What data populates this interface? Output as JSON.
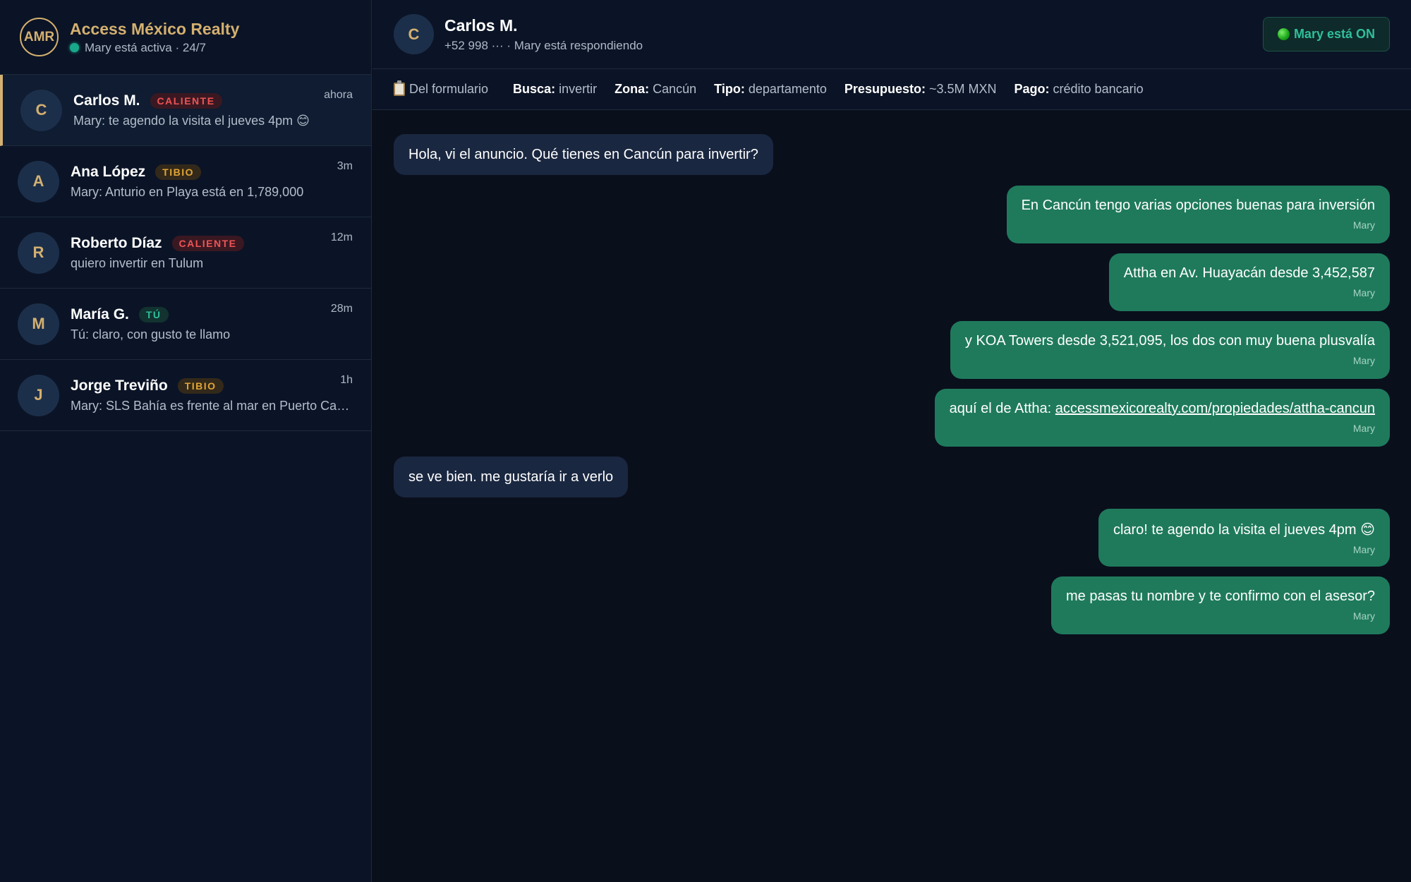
{
  "brand": {
    "logo": "AMR",
    "name": "Access México Realty",
    "status": "Mary está activa · 24/7",
    "status_color": "#19a88a"
  },
  "conversations": [
    {
      "initial": "C",
      "name": "Carlos M.",
      "tag": "CALIENTE",
      "tag_kind": "hot",
      "preview": "Mary: te agendo la visita el jueves 4pm 😊",
      "time": "ahora",
      "active": true
    },
    {
      "initial": "A",
      "name": "Ana López",
      "tag": "TIBIO",
      "tag_kind": "warm",
      "preview": "Mary: Anturio en Playa está en 1,789,000",
      "time": "3m",
      "active": false
    },
    {
      "initial": "R",
      "name": "Roberto Díaz",
      "tag": "CALIENTE",
      "tag_kind": "hot",
      "preview": "quiero invertir en Tulum",
      "time": "12m",
      "active": false
    },
    {
      "initial": "M",
      "name": "María G.",
      "tag": "TÚ",
      "tag_kind": "you",
      "preview": "Tú: claro, con gusto te llamo",
      "time": "28m",
      "active": false
    },
    {
      "initial": "J",
      "name": "Jorge Treviño",
      "tag": "TIBIO",
      "tag_kind": "warm",
      "preview": "Mary: SLS Bahía es frente al mar en Puerto Cancún",
      "time": "1h",
      "active": false
    }
  ],
  "chat": {
    "initial": "C",
    "name": "Carlos M.",
    "subtitle": "+52 998 ··· · Mary está respondiendo",
    "toggle_label": "Mary está ON"
  },
  "form": {
    "source_label": "Del formulario",
    "fields": [
      {
        "key": "Busca:",
        "value": "invertir"
      },
      {
        "key": "Zona:",
        "value": "Cancún"
      },
      {
        "key": "Tipo:",
        "value": "departamento"
      },
      {
        "key": "Presupuesto:",
        "value": "~3.5M MXN"
      },
      {
        "key": "Pago:",
        "value": "crédito bancario"
      }
    ]
  },
  "messages": [
    {
      "dir": "in",
      "text": "Hola, vi el anuncio. Qué tienes en Cancún para invertir?"
    },
    {
      "dir": "out",
      "text": "En Cancún tengo varias opciones buenas para inversión",
      "sender": "Mary"
    },
    {
      "dir": "out",
      "text": "Attha en Av. Huayacán desde 3,452,587",
      "sender": "Mary"
    },
    {
      "dir": "out",
      "text": "y KOA Towers desde 3,521,095, los dos con muy buena plusvalía",
      "sender": "Mary"
    },
    {
      "dir": "out",
      "text_prefix": "aquí el de Attha: ",
      "link": "accessmexicorealty.com/propiedades/attha-cancun",
      "sender": "Mary"
    },
    {
      "dir": "in",
      "text": "se ve bien. me gustaría ir a verlo"
    },
    {
      "dir": "out",
      "text": "claro! te agendo la visita el jueves 4pm 😊",
      "sender": "Mary"
    },
    {
      "dir": "out",
      "text": "me pasas tu nombre y te confirmo con el asesor?",
      "sender": "Mary"
    }
  ]
}
